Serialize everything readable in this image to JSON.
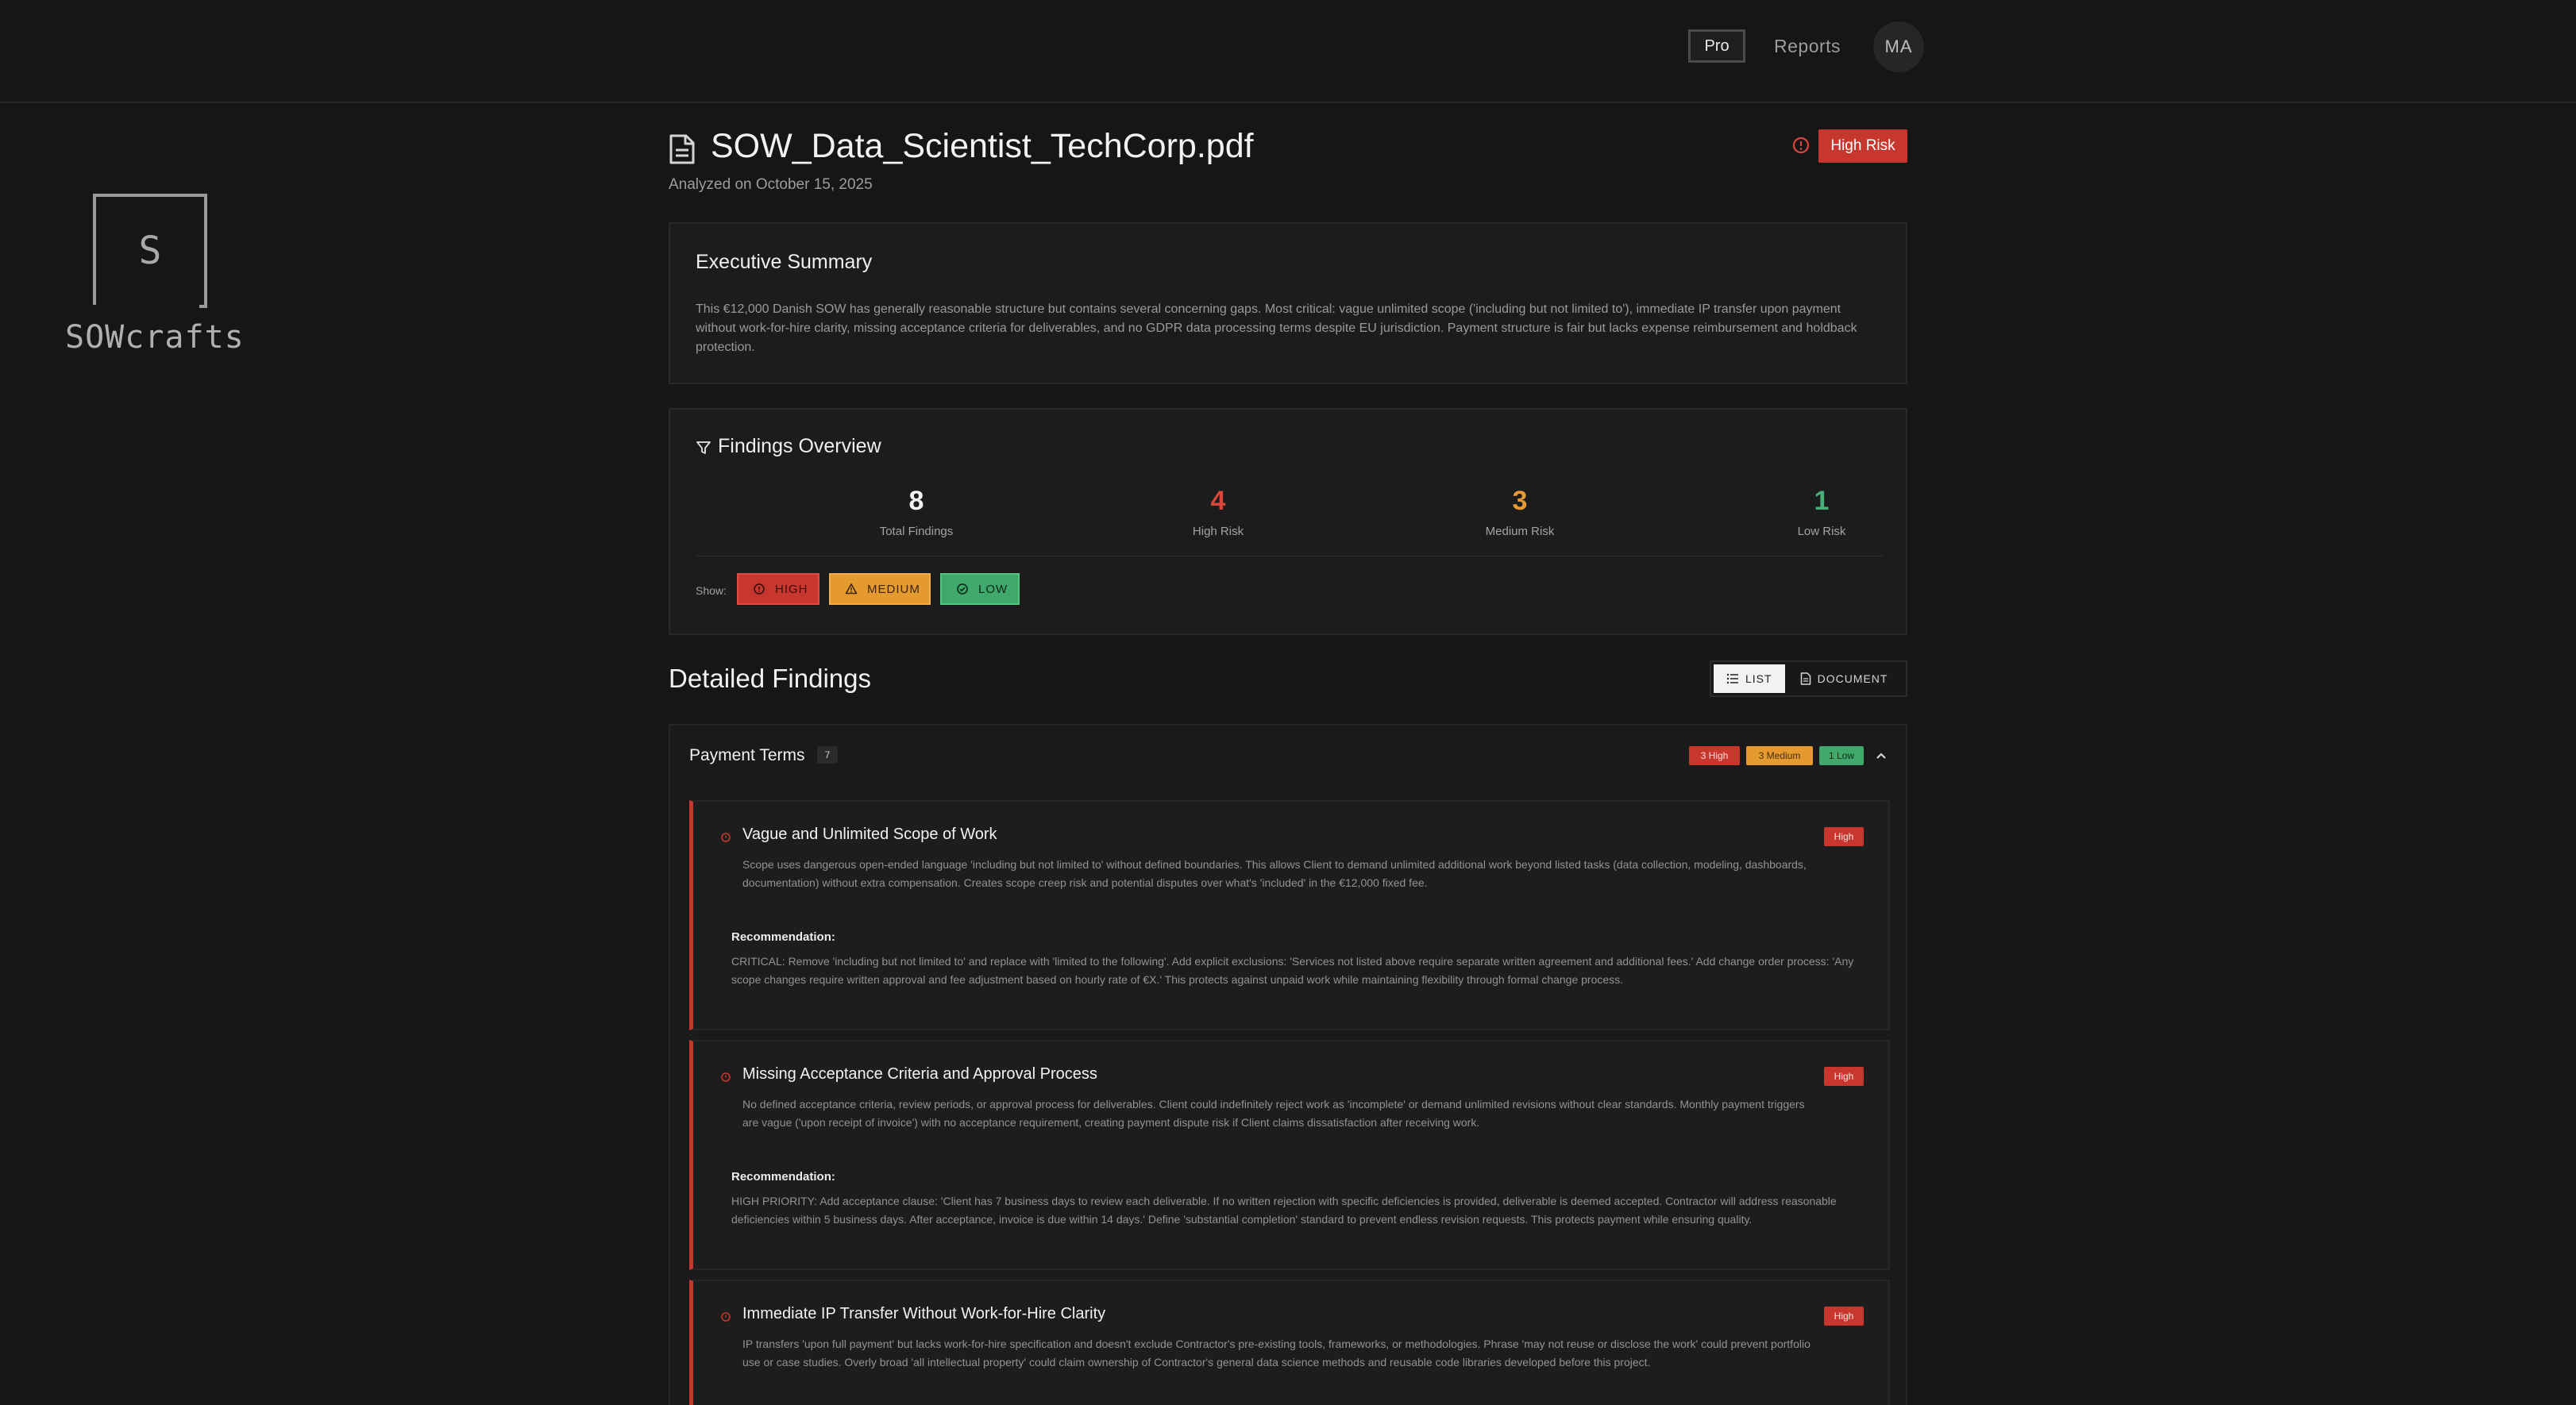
{
  "header": {
    "pro_label": "Pro",
    "reports_label": "Reports",
    "avatar_initials": "MA"
  },
  "brand": {
    "logo_letter": "S",
    "name": "SOWcrafts"
  },
  "document": {
    "title": "SOW_Data_Scientist_TechCorp.pdf",
    "analyzed": "Analyzed on October 15, 2025",
    "risk_badge": "High Risk",
    "risk_color": "#c8372e"
  },
  "summary": {
    "title": "Executive Summary",
    "text": "This €12,000 Danish SOW has generally reasonable structure but contains several concerning gaps. Most critical: vague unlimited scope ('including but not limited to'), immediate IP transfer upon payment without work-for-hire clarity, missing acceptance criteria for deliverables, and no GDPR data processing terms despite EU jurisdiction. Payment structure is fair but lacks expense reimbursement and holdback protection."
  },
  "overview": {
    "title": "Findings Overview",
    "stats": [
      {
        "value": "8",
        "label": "Total Findings",
        "color": "#f2f2f2"
      },
      {
        "value": "4",
        "label": "High Risk",
        "color": "#d9473c"
      },
      {
        "value": "3",
        "label": "Medium Risk",
        "color": "#e69a33"
      },
      {
        "value": "1",
        "label": "Low Risk",
        "color": "#46b277"
      }
    ],
    "show_label": "Show:",
    "filters": [
      "HIGH",
      "MEDIUM",
      "LOW"
    ]
  },
  "detailed": {
    "title": "Detailed Findings",
    "view_list": "LIST",
    "view_document": "DOCUMENT"
  },
  "section": {
    "title": "Payment Terms",
    "count": "7",
    "badges": [
      "3 High",
      "3 Medium",
      "1 Low"
    ],
    "findings": [
      {
        "title": "Vague and Unlimited Scope of Work",
        "badge": "High",
        "description": "Scope uses dangerous open-ended language 'including but not limited to' without defined boundaries. This allows Client to demand unlimited additional work beyond listed tasks (data collection, modeling, dashboards, documentation) without extra compensation. Creates scope creep risk and potential disputes over what's 'included' in the €12,000 fixed fee.",
        "rec_label": "Recommendation:",
        "recommendation": "CRITICAL: Remove 'including but not limited to' and replace with 'limited to the following'. Add explicit exclusions: 'Services not listed above require separate written agreement and additional fees.' Add change order process: 'Any scope changes require written approval and fee adjustment based on hourly rate of €X.' This protects against unpaid work while maintaining flexibility through formal change process."
      },
      {
        "title": "Missing Acceptance Criteria and Approval Process",
        "badge": "High",
        "description": "No defined acceptance criteria, review periods, or approval process for deliverables. Client could indefinitely reject work as 'incomplete' or demand unlimited revisions without clear standards. Monthly payment triggers are vague ('upon receipt of invoice') with no acceptance requirement, creating payment dispute risk if Client claims dissatisfaction after receiving work.",
        "rec_label": "Recommendation:",
        "recommendation": "HIGH PRIORITY: Add acceptance clause: 'Client has 7 business days to review each deliverable. If no written rejection with specific deficiencies is provided, deliverable is deemed accepted. Contractor will address reasonable deficiencies within 5 business days. After acceptance, invoice is due within 14 days.' Define 'substantial completion' standard to prevent endless revision requests. This protects payment while ensuring quality."
      },
      {
        "title": "Immediate IP Transfer Without Work-for-Hire Clarity",
        "badge": "High",
        "description": "IP transfers 'upon full payment' but lacks work-for-hire specification and doesn't exclude Contractor's pre-existing tools, frameworks, or methodologies. Phrase 'may not reuse or disclose the work' could prevent portfolio use or case studies. Overly broad 'all intellectual property' could claim ownership of Contractor's general data science methods and reusable code libraries developed before this project."
      }
    ]
  }
}
